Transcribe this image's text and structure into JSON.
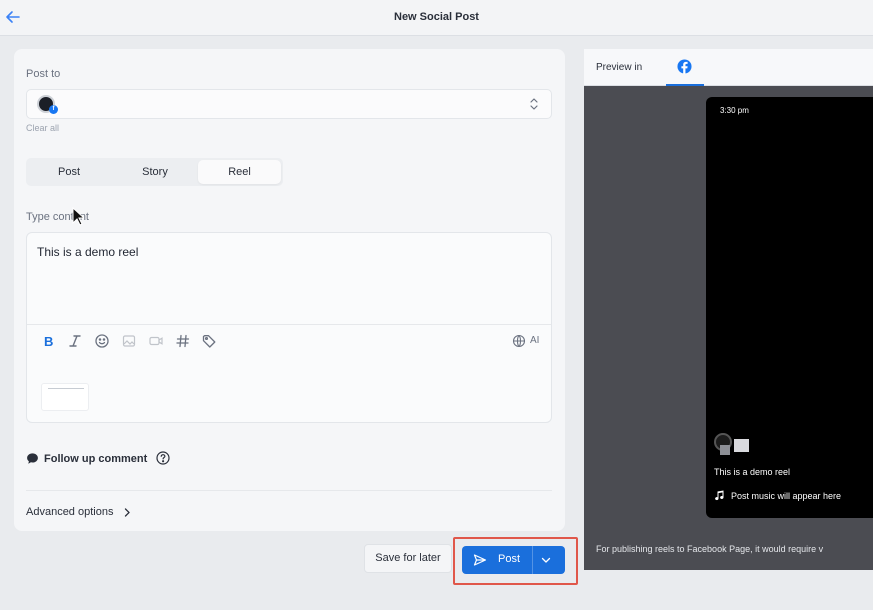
{
  "header": {
    "title": "New Social Post",
    "back_icon": "arrow-left-icon"
  },
  "composer": {
    "post_to_label": "Post to",
    "clear_all": "Clear all",
    "account_badge": "f",
    "tabs": [
      {
        "label": "Post",
        "active": false
      },
      {
        "label": "Story",
        "active": false
      },
      {
        "label": "Reel",
        "active": true
      }
    ],
    "content_label": "Type content",
    "content_text": "This is a demo reel",
    "toolbar_icons": [
      "bold-icon",
      "italic-icon",
      "emoji-icon",
      "image-icon",
      "video-icon",
      "hashtag-icon",
      "tag-icon"
    ],
    "ai_label": "AI",
    "follow_up_label": "Follow up comment",
    "advanced_label": "Advanced options"
  },
  "footer": {
    "save_later_label": "Save for later",
    "post_label": "Post",
    "highlight_color": "#e0574a",
    "primary_color": "#1a6fdc"
  },
  "preview": {
    "label": "Preview in",
    "platform_icon": "facebook-icon",
    "time": "3:30 pm",
    "caption": "This is a demo reel",
    "music": "Post music will appear here",
    "note": "For publishing reels to Facebook Page, it would require v"
  }
}
